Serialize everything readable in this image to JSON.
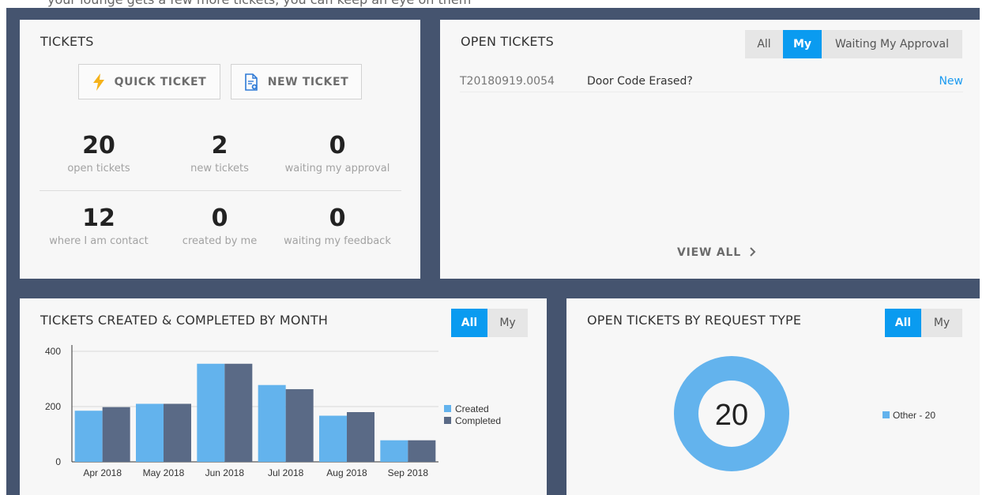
{
  "top_caption": "your lounge gets a few more tickets, you can keep an eye on them",
  "tickets": {
    "title": "TICKETS",
    "quick_ticket_label": "QUICK TICKET",
    "new_ticket_label": "NEW TICKET",
    "stats": [
      {
        "value": "20",
        "label": "open tickets"
      },
      {
        "value": "2",
        "label": "new tickets"
      },
      {
        "value": "0",
        "label": "waiting my approval"
      },
      {
        "value": "12",
        "label": "where I am contact"
      },
      {
        "value": "0",
        "label": "created by me"
      },
      {
        "value": "0",
        "label": "waiting my feedback"
      }
    ]
  },
  "open_tickets": {
    "title": "OPEN TICKETS",
    "filters": [
      {
        "label": "All",
        "active": false
      },
      {
        "label": "My",
        "active": true
      },
      {
        "label": "Waiting My Approval",
        "active": false
      }
    ],
    "rows": [
      {
        "id": "T20180919.0054",
        "subject": "Door Code Erased?",
        "status": "New"
      }
    ],
    "view_all_label": "VIEW ALL"
  },
  "monthly": {
    "title": "TICKETS CREATED & COMPLETED BY MONTH",
    "filters": [
      {
        "label": "All",
        "active": true
      },
      {
        "label": "My",
        "active": false
      }
    ]
  },
  "request_type": {
    "title": "OPEN TICKETS BY REQUEST TYPE",
    "filters": [
      {
        "label": "All",
        "active": true
      },
      {
        "label": "My",
        "active": false
      }
    ],
    "center_value": "20"
  },
  "colors": {
    "frame": "#45546f",
    "accent": "#0a9bf0",
    "created": "#63b3ed",
    "completed": "#5a6a86",
    "pie": "#63b3ed",
    "bolt": "#f5b21a",
    "doc_icon": "#2e7ad6"
  },
  "chart_data": [
    {
      "type": "bar",
      "categories": [
        "Apr 2018",
        "May 2018",
        "Jun 2018",
        "Jul 2018",
        "Aug 2018",
        "Sep 2018"
      ],
      "series": [
        {
          "name": "Created",
          "values": [
            185,
            210,
            355,
            278,
            167,
            78
          ]
        },
        {
          "name": "Completed",
          "values": [
            198,
            210,
            355,
            263,
            180,
            78
          ]
        }
      ],
      "ylim": [
        0,
        400
      ],
      "yticks": [
        0,
        200,
        400
      ],
      "grid": true,
      "legend": "right"
    },
    {
      "type": "pie",
      "donut": true,
      "slices": [
        {
          "label": "Other - 20",
          "value": 20
        }
      ],
      "legend": "right"
    }
  ]
}
